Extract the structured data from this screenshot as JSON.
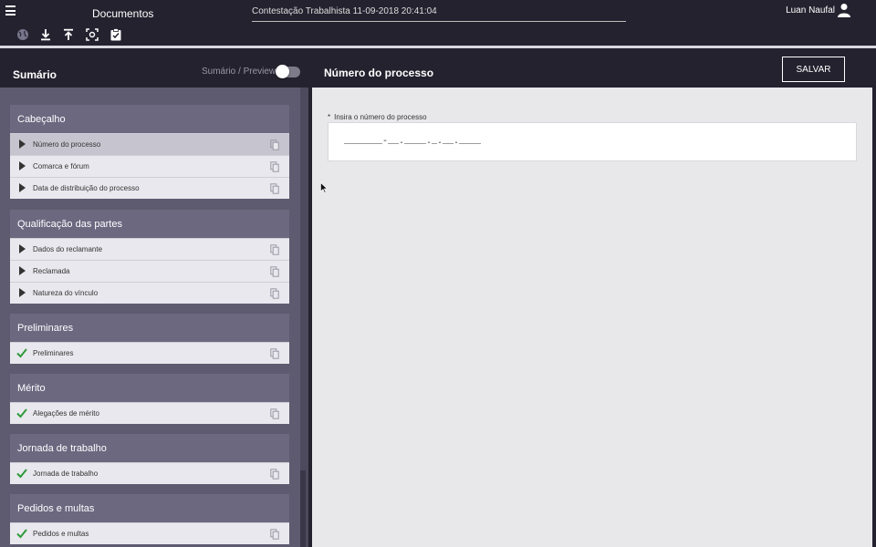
{
  "topbar": {
    "app_title": "Documentos",
    "document_title": "Contestação Trabalhista 11-09-2018 20:41:04",
    "user_name": "Luan Naufal"
  },
  "toolbar": {
    "icons": [
      "globe-icon",
      "download-icon",
      "upload-icon",
      "focus-icon",
      "clipboard-check-icon"
    ]
  },
  "sidebar": {
    "title": "Sumário",
    "toggle_label": "Sumário / Preview",
    "sections": [
      {
        "title": "Cabeçalho",
        "items": [
          {
            "label": "Número do processo",
            "status": "pending",
            "active": true
          },
          {
            "label": "Comarca e fórum",
            "status": "pending"
          },
          {
            "label": "Data de distribuição do processo",
            "status": "pending"
          }
        ]
      },
      {
        "title": "Qualificação das partes",
        "items": [
          {
            "label": "Dados do reclamante",
            "status": "pending"
          },
          {
            "label": "Reclamada",
            "status": "pending"
          },
          {
            "label": "Natureza do vínculo",
            "status": "pending"
          }
        ]
      },
      {
        "title": "Preliminares",
        "items": [
          {
            "label": "Preliminares",
            "status": "done"
          }
        ]
      },
      {
        "title": "Mérito",
        "items": [
          {
            "label": "Alegações de mérito",
            "status": "done"
          }
        ]
      },
      {
        "title": "Jornada de trabalho",
        "items": [
          {
            "label": "Jornada de trabalho",
            "status": "done"
          }
        ]
      },
      {
        "title": "Pedidos e multas",
        "items": [
          {
            "label": "Pedidos e multas",
            "status": "done"
          }
        ]
      }
    ]
  },
  "main": {
    "title": "Número do processo",
    "save_label": "SALVAR",
    "field": {
      "required_mark": "*",
      "label": "Insira o número do processo",
      "value": "_______-__.____._.__.____"
    }
  },
  "colors": {
    "background": "#24222f",
    "panel": "#5e5b70",
    "section_head": "#6b6880",
    "check": "#2e9a3a"
  }
}
